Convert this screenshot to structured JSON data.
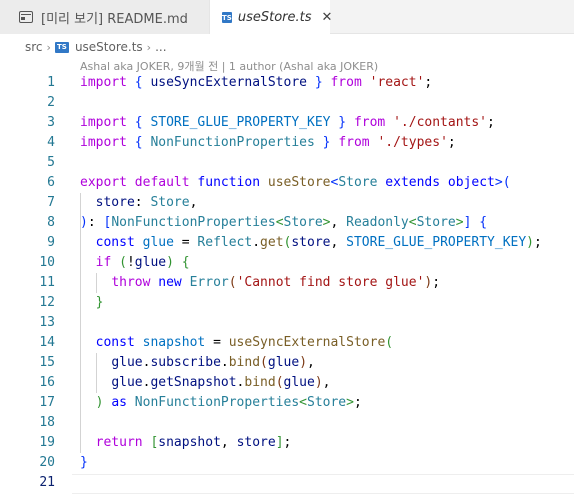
{
  "tabs": [
    {
      "label": "[미리 보기] README.md",
      "kind": "preview"
    },
    {
      "label": "useStore.ts",
      "kind": "active",
      "icon": "TS"
    }
  ],
  "breadcrumb": {
    "folder": "src",
    "file": "useStore.ts",
    "more": "..."
  },
  "blame": "Ashal aka JOKER, 9개월 전 | 1 author (Ashal aka JOKER)",
  "current_line": 21,
  "code_lines": [
    {
      "n": "1",
      "parts": [
        [
          "kw2",
          "import"
        ],
        [
          "p",
          " "
        ],
        [
          "b1",
          "{"
        ],
        [
          "p",
          " "
        ],
        [
          "var",
          "useSyncExternalStore"
        ],
        [
          "p",
          " "
        ],
        [
          "b1",
          "}"
        ],
        [
          "p",
          " "
        ],
        [
          "kw2",
          "from"
        ],
        [
          "p",
          " "
        ],
        [
          "str",
          "'react'"
        ],
        [
          "p",
          ";"
        ]
      ]
    },
    {
      "n": "2",
      "parts": []
    },
    {
      "n": "3",
      "parts": [
        [
          "kw2",
          "import"
        ],
        [
          "p",
          " "
        ],
        [
          "b1",
          "{"
        ],
        [
          "p",
          " "
        ],
        [
          "const",
          "STORE_GLUE_PROPERTY_KEY"
        ],
        [
          "p",
          " "
        ],
        [
          "b1",
          "}"
        ],
        [
          "p",
          " "
        ],
        [
          "kw2",
          "from"
        ],
        [
          "p",
          " "
        ],
        [
          "str",
          "'./contants'"
        ],
        [
          "p",
          ";"
        ]
      ]
    },
    {
      "n": "4",
      "parts": [
        [
          "kw2",
          "import"
        ],
        [
          "p",
          " "
        ],
        [
          "b1",
          "{"
        ],
        [
          "p",
          " "
        ],
        [
          "ty",
          "NonFunctionProperties"
        ],
        [
          "p",
          " "
        ],
        [
          "b1",
          "}"
        ],
        [
          "p",
          " "
        ],
        [
          "kw2",
          "from"
        ],
        [
          "p",
          " "
        ],
        [
          "str",
          "'./types'"
        ],
        [
          "p",
          ";"
        ]
      ]
    },
    {
      "n": "5",
      "parts": []
    },
    {
      "n": "6",
      "parts": [
        [
          "kw2",
          "export"
        ],
        [
          "p",
          " "
        ],
        [
          "kw2",
          "default"
        ],
        [
          "p",
          " "
        ],
        [
          "kw",
          "function"
        ],
        [
          "p",
          " "
        ],
        [
          "fn",
          "useStore"
        ],
        [
          "b1",
          "<"
        ],
        [
          "ty",
          "Store"
        ],
        [
          "p",
          " "
        ],
        [
          "kw",
          "extends"
        ],
        [
          "p",
          " "
        ],
        [
          "kw",
          "object"
        ],
        [
          "b1",
          ">"
        ],
        [
          "b1",
          "("
        ]
      ]
    },
    {
      "n": "7",
      "parts": [
        [
          "p",
          "  "
        ],
        [
          "var",
          "store"
        ],
        [
          "p",
          ": "
        ],
        [
          "ty",
          "Store"
        ],
        [
          "p",
          ","
        ]
      ]
    },
    {
      "n": "8",
      "parts": [
        [
          "b1",
          ")"
        ],
        [
          "p",
          ": "
        ],
        [
          "b1",
          "["
        ],
        [
          "ty",
          "NonFunctionProperties"
        ],
        [
          "b2",
          "<"
        ],
        [
          "ty",
          "Store"
        ],
        [
          "b2",
          ">"
        ],
        [
          "p",
          ", "
        ],
        [
          "ty",
          "Readonly"
        ],
        [
          "b2",
          "<"
        ],
        [
          "ty",
          "Store"
        ],
        [
          "b2",
          ">"
        ],
        [
          "b1",
          "]"
        ],
        [
          "p",
          " "
        ],
        [
          "b1",
          "{"
        ]
      ]
    },
    {
      "n": "9",
      "parts": [
        [
          "p",
          "  "
        ],
        [
          "kw",
          "const"
        ],
        [
          "p",
          " "
        ],
        [
          "const",
          "glue"
        ],
        [
          "p",
          " = "
        ],
        [
          "ty",
          "Reflect"
        ],
        [
          "p",
          "."
        ],
        [
          "fn",
          "get"
        ],
        [
          "b2",
          "("
        ],
        [
          "var",
          "store"
        ],
        [
          "p",
          ", "
        ],
        [
          "const",
          "STORE_GLUE_PROPERTY_KEY"
        ],
        [
          "b2",
          ")"
        ],
        [
          "p",
          ";"
        ]
      ]
    },
    {
      "n": "10",
      "parts": [
        [
          "p",
          "  "
        ],
        [
          "kw2",
          "if"
        ],
        [
          "p",
          " "
        ],
        [
          "b2",
          "("
        ],
        [
          "p",
          "!"
        ],
        [
          "var",
          "glue"
        ],
        [
          "b2",
          ")"
        ],
        [
          "p",
          " "
        ],
        [
          "b2",
          "{"
        ]
      ]
    },
    {
      "n": "11",
      "parts": [
        [
          "p",
          "    "
        ],
        [
          "kw2",
          "throw"
        ],
        [
          "p",
          " "
        ],
        [
          "kw",
          "new"
        ],
        [
          "p",
          " "
        ],
        [
          "ty",
          "Error"
        ],
        [
          "b3",
          "("
        ],
        [
          "str",
          "'Cannot find store glue'"
        ],
        [
          "b3",
          ")"
        ],
        [
          "p",
          ";"
        ]
      ]
    },
    {
      "n": "12",
      "parts": [
        [
          "p",
          "  "
        ],
        [
          "b2",
          "}"
        ]
      ]
    },
    {
      "n": "13",
      "parts": []
    },
    {
      "n": "14",
      "parts": [
        [
          "p",
          "  "
        ],
        [
          "kw",
          "const"
        ],
        [
          "p",
          " "
        ],
        [
          "const",
          "snapshot"
        ],
        [
          "p",
          " = "
        ],
        [
          "fn",
          "useSyncExternalStore"
        ],
        [
          "b2",
          "("
        ]
      ]
    },
    {
      "n": "15",
      "parts": [
        [
          "p",
          "    "
        ],
        [
          "var",
          "glue"
        ],
        [
          "p",
          "."
        ],
        [
          "var",
          "subscribe"
        ],
        [
          "p",
          "."
        ],
        [
          "fn",
          "bind"
        ],
        [
          "b3",
          "("
        ],
        [
          "var",
          "glue"
        ],
        [
          "b3",
          ")"
        ],
        [
          "p",
          ","
        ]
      ]
    },
    {
      "n": "16",
      "parts": [
        [
          "p",
          "    "
        ],
        [
          "var",
          "glue"
        ],
        [
          "p",
          "."
        ],
        [
          "var",
          "getSnapshot"
        ],
        [
          "p",
          "."
        ],
        [
          "fn",
          "bind"
        ],
        [
          "b3",
          "("
        ],
        [
          "var",
          "glue"
        ],
        [
          "b3",
          ")"
        ],
        [
          "p",
          ","
        ]
      ]
    },
    {
      "n": "17",
      "parts": [
        [
          "p",
          "  "
        ],
        [
          "b2",
          ")"
        ],
        [
          "p",
          " "
        ],
        [
          "kw",
          "as"
        ],
        [
          "p",
          " "
        ],
        [
          "ty",
          "NonFunctionProperties"
        ],
        [
          "b2",
          "<"
        ],
        [
          "ty",
          "Store"
        ],
        [
          "b2",
          ">"
        ],
        [
          "p",
          ";"
        ]
      ]
    },
    {
      "n": "18",
      "parts": []
    },
    {
      "n": "19",
      "parts": [
        [
          "p",
          "  "
        ],
        [
          "kw2",
          "return"
        ],
        [
          "p",
          " "
        ],
        [
          "b2",
          "["
        ],
        [
          "var",
          "snapshot"
        ],
        [
          "p",
          ", "
        ],
        [
          "var",
          "store"
        ],
        [
          "b2",
          "]"
        ],
        [
          "p",
          ";"
        ]
      ]
    },
    {
      "n": "20",
      "parts": [
        [
          "b1",
          "}"
        ]
      ]
    },
    {
      "n": "21",
      "parts": []
    }
  ]
}
